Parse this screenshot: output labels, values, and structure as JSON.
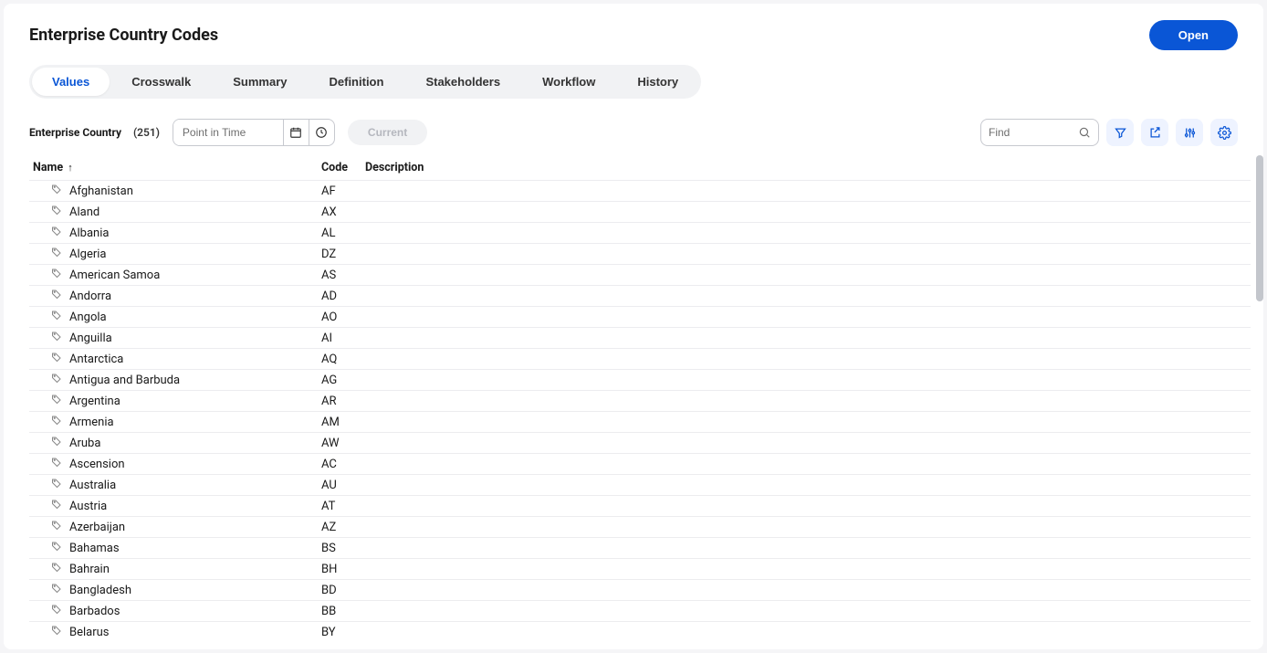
{
  "header": {
    "title": "Enterprise Country Codes",
    "open_label": "Open"
  },
  "tabs": [
    {
      "key": "values",
      "label": "Values",
      "active": true
    },
    {
      "key": "crosswalk",
      "label": "Crosswalk",
      "active": false
    },
    {
      "key": "summary",
      "label": "Summary",
      "active": false
    },
    {
      "key": "definition",
      "label": "Definition",
      "active": false
    },
    {
      "key": "stakeholders",
      "label": "Stakeholders",
      "active": false
    },
    {
      "key": "workflow",
      "label": "Workflow",
      "active": false
    },
    {
      "key": "history",
      "label": "History",
      "active": false
    }
  ],
  "toolbar": {
    "entity_label": "Enterprise Country",
    "count_label": "(251)",
    "point_in_time_placeholder": "Point in Time",
    "current_label": "Current",
    "find_placeholder": "Find"
  },
  "columns": {
    "name": "Name",
    "code": "Code",
    "description": "Description"
  },
  "rows": [
    {
      "name": "Afghanistan",
      "code": "AF",
      "description": ""
    },
    {
      "name": "Aland",
      "code": "AX",
      "description": ""
    },
    {
      "name": "Albania",
      "code": "AL",
      "description": ""
    },
    {
      "name": "Algeria",
      "code": "DZ",
      "description": ""
    },
    {
      "name": "American Samoa",
      "code": "AS",
      "description": ""
    },
    {
      "name": "Andorra",
      "code": "AD",
      "description": ""
    },
    {
      "name": "Angola",
      "code": "AO",
      "description": ""
    },
    {
      "name": "Anguilla",
      "code": "AI",
      "description": ""
    },
    {
      "name": "Antarctica",
      "code": "AQ",
      "description": ""
    },
    {
      "name": "Antigua and Barbuda",
      "code": "AG",
      "description": ""
    },
    {
      "name": "Argentina",
      "code": "AR",
      "description": ""
    },
    {
      "name": "Armenia",
      "code": "AM",
      "description": ""
    },
    {
      "name": "Aruba",
      "code": "AW",
      "description": ""
    },
    {
      "name": "Ascension",
      "code": "AC",
      "description": ""
    },
    {
      "name": "Australia",
      "code": "AU",
      "description": ""
    },
    {
      "name": "Austria",
      "code": "AT",
      "description": ""
    },
    {
      "name": "Azerbaijan",
      "code": "AZ",
      "description": ""
    },
    {
      "name": "Bahamas",
      "code": "BS",
      "description": ""
    },
    {
      "name": "Bahrain",
      "code": "BH",
      "description": ""
    },
    {
      "name": "Bangladesh",
      "code": "BD",
      "description": ""
    },
    {
      "name": "Barbados",
      "code": "BB",
      "description": ""
    },
    {
      "name": "Belarus",
      "code": "BY",
      "description": ""
    }
  ]
}
